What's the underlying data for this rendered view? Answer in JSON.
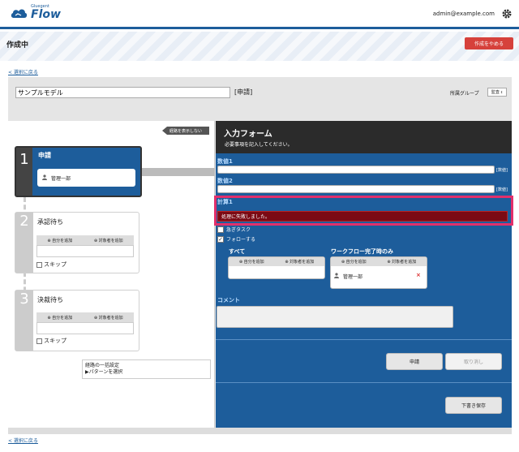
{
  "header": {
    "logo_small": "Gluegent",
    "logo_big": "Flow",
    "user_email": "admin@example.com"
  },
  "titlebar": {
    "title": "作成中",
    "cancel_label": "作成をやめる"
  },
  "nav": {
    "back_top": "< 選択に戻る",
    "back_bottom": "< 選択に戻る"
  },
  "model": {
    "name": "サンプルモデル",
    "type_label": "[申請]",
    "group_label": "所属グループ",
    "group_value": "監査"
  },
  "route": {
    "hide_label": "経路を表示しない",
    "steps": [
      {
        "num": "1",
        "title": "申請",
        "assignee": "管理一部"
      },
      {
        "num": "2",
        "title": "承認待ち",
        "add_self": "自分を追加",
        "add_target": "対象者を追加",
        "skip": "スキップ"
      },
      {
        "num": "3",
        "title": "決裁待ち",
        "add_self": "自分を追加",
        "add_target": "対象者を追加",
        "skip": "スキップ"
      }
    ],
    "bulk_line1": "経路の一括設定",
    "bulk_line2": "▶パターンを選択"
  },
  "form": {
    "title": "入力フォーム",
    "subtitle": "必要事項を記入してください。",
    "fields": [
      {
        "label": "数値1",
        "unit": "[数値]"
      },
      {
        "label": "数値2",
        "unit": "[数値]"
      },
      {
        "label": "計算1"
      }
    ],
    "error": "処理に失敗しました。",
    "urgent_label": "急ぎタスク",
    "follow_label": "フォローする",
    "all_title": "すべて",
    "wf_title": "ワークフロー完了時のみ",
    "add_self": "自分を追加",
    "add_target": "対象者を追加",
    "wf_member": "管理一部",
    "comment_label": "コメント",
    "apply_label": "申請",
    "undo_label": "取り消し",
    "draft_label": "下書き保存"
  }
}
